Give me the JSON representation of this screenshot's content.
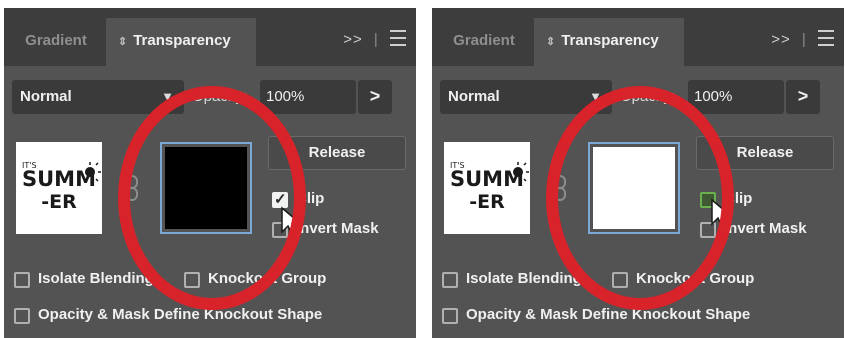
{
  "panels": [
    {
      "tabs": {
        "inactive": "Gradient",
        "active": "Transparency"
      },
      "overflow": ">>",
      "blend_mode": "Normal",
      "opacity_label": "Opacity:",
      "opacity_value": "100%",
      "opacity_arrow": ">",
      "thumbnail_text": "SUMMER",
      "mask_fill": "#000000",
      "release": "Release",
      "clip": {
        "label": "Clip",
        "checked": true
      },
      "invert": {
        "label": "Invert Mask",
        "checked": false
      },
      "isolate": {
        "label": "Isolate Blending",
        "checked": false
      },
      "knockout": {
        "label": "Knockout Group",
        "checked": false
      },
      "opacity_mask": {
        "label": "Opacity & Mask Define Knockout Shape",
        "checked": false
      }
    },
    {
      "tabs": {
        "inactive": "Gradient",
        "active": "Transparency"
      },
      "overflow": ">>",
      "blend_mode": "Normal",
      "opacity_label": "Opacity:",
      "opacity_value": "100%",
      "opacity_arrow": ">",
      "thumbnail_text": "SUMMER",
      "mask_fill": "#ffffff",
      "release": "Release",
      "clip": {
        "label": "Clip",
        "checked": false
      },
      "invert": {
        "label": "Invert Mask",
        "checked": false
      },
      "isolate": {
        "label": "Isolate Blending",
        "checked": false
      },
      "knockout": {
        "label": "Knockout Group",
        "checked": false
      },
      "opacity_mask": {
        "label": "Opacity & Mask Define Knockout Shape",
        "checked": false
      }
    }
  ],
  "colors": {
    "panel": "#535353",
    "tabbar": "#3d3d3d",
    "annotation_ring": "#d8232a",
    "mask_border": "#7aa8d6"
  },
  "icons": [
    "link-icon",
    "menu-icon",
    "cursor-arrow-icon",
    "dropdown-caret-icon"
  ]
}
